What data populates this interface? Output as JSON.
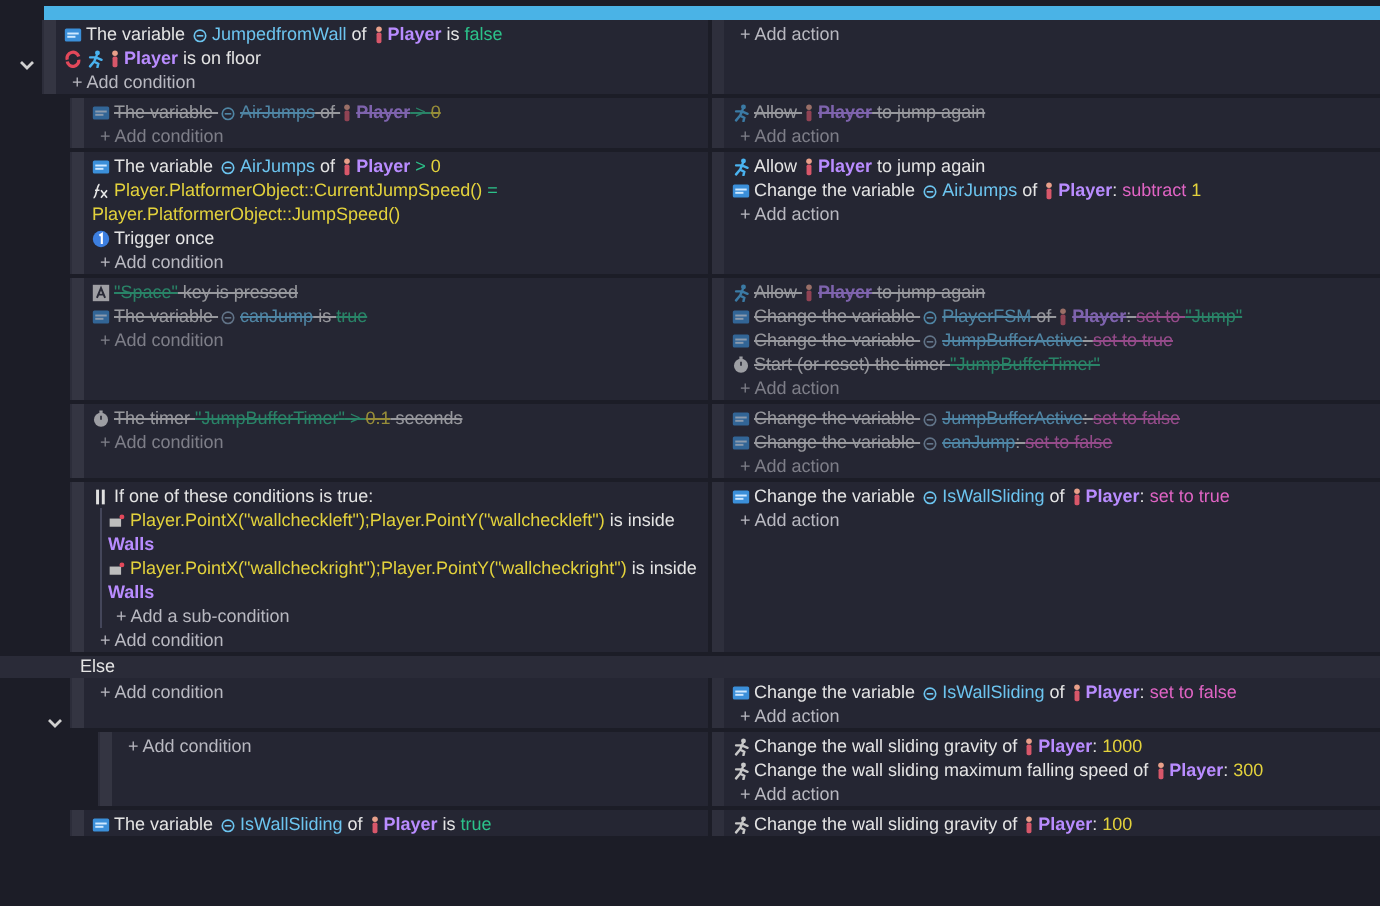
{
  "events": [
    {
      "kind": "event",
      "disabled": false,
      "expanded": true,
      "conditions": [
        {
          "kind": "variable",
          "parts": [
            {
              "kind": "plain",
              "text": "The variable "
            },
            {
              "kind": "var",
              "text": "JumpedfromWall"
            },
            {
              "kind": "plain",
              "text": " of "
            },
            {
              "kind": "object",
              "text": "Player"
            },
            {
              "kind": "plain",
              "text": " is "
            },
            {
              "kind": "bool",
              "text": "false"
            }
          ]
        },
        {
          "kind": "floor",
          "parts": [
            {
              "kind": "object",
              "text": "Player"
            },
            {
              "kind": "plain",
              "text": " is on floor"
            }
          ]
        }
      ],
      "add_condition": "+ Add condition",
      "add_action": "+ Add action",
      "children": [
        {
          "kind": "event",
          "disabled": true,
          "conditions": [
            {
              "kind": "variable",
              "parts": [
                {
                  "kind": "plain",
                  "text": "The variable "
                },
                {
                  "kind": "var",
                  "text": "AirJumps"
                },
                {
                  "kind": "plain",
                  "text": " of "
                },
                {
                  "kind": "object",
                  "text": "Player"
                },
                {
                  "kind": "op",
                  "text": " > "
                },
                {
                  "kind": "num",
                  "text": "0"
                }
              ]
            }
          ],
          "add_condition": "+ Add condition",
          "actions": [
            {
              "kind": "platformer",
              "parts": [
                {
                  "kind": "plain",
                  "text": "Allow "
                },
                {
                  "kind": "object",
                  "text": "Player"
                },
                {
                  "kind": "plain",
                  "text": " to jump again"
                }
              ]
            }
          ],
          "add_action": "+ Add action"
        },
        {
          "kind": "event",
          "disabled": false,
          "conditions": [
            {
              "kind": "variable",
              "parts": [
                {
                  "kind": "plain",
                  "text": "The variable "
                },
                {
                  "kind": "var",
                  "text": "AirJumps"
                },
                {
                  "kind": "plain",
                  "text": " of "
                },
                {
                  "kind": "object",
                  "text": "Player"
                },
                {
                  "kind": "op",
                  "text": " > "
                },
                {
                  "kind": "num",
                  "text": "0"
                }
              ]
            },
            {
              "kind": "expression",
              "parts": [
                {
                  "kind": "expr",
                  "text": "Player.PlatformerObject::CurrentJumpSpeed()"
                },
                {
                  "kind": "op",
                  "text": " = "
                },
                {
                  "kind": "expr",
                  "text": "Player.PlatformerObject::JumpSpeed()"
                }
              ]
            },
            {
              "kind": "once",
              "parts": [
                {
                  "kind": "plain",
                  "text": "Trigger once"
                }
              ]
            }
          ],
          "add_condition": "+ Add condition",
          "actions": [
            {
              "kind": "platformer",
              "parts": [
                {
                  "kind": "plain",
                  "text": "Allow "
                },
                {
                  "kind": "object",
                  "text": "Player"
                },
                {
                  "kind": "plain",
                  "text": " to jump again"
                }
              ]
            },
            {
              "kind": "variable",
              "parts": [
                {
                  "kind": "plain",
                  "text": "Change the variable "
                },
                {
                  "kind": "var",
                  "text": "AirJumps"
                },
                {
                  "kind": "plain",
                  "text": " of "
                },
                {
                  "kind": "object",
                  "text": "Player"
                },
                {
                  "kind": "plain",
                  "text": ": "
                },
                {
                  "kind": "act",
                  "text": "subtract"
                },
                {
                  "kind": "num",
                  "text": " 1"
                }
              ]
            }
          ],
          "add_action": "+ Add action"
        },
        {
          "kind": "event",
          "disabled": true,
          "conditions": [
            {
              "kind": "key",
              "parts": [
                {
                  "kind": "str",
                  "text": "\"Space\""
                },
                {
                  "kind": "plain",
                  "text": " key is pressed"
                }
              ]
            },
            {
              "kind": "variable",
              "parts": [
                {
                  "kind": "plain",
                  "text": "The variable "
                },
                {
                  "kind": "gvar",
                  "text": "canJump"
                },
                {
                  "kind": "plain",
                  "text": " is "
                },
                {
                  "kind": "bool",
                  "text": "true"
                }
              ]
            }
          ],
          "add_condition": "+ Add condition",
          "actions": [
            {
              "kind": "platformer",
              "parts": [
                {
                  "kind": "plain",
                  "text": "Allow "
                },
                {
                  "kind": "object",
                  "text": "Player"
                },
                {
                  "kind": "plain",
                  "text": " to jump again"
                }
              ]
            },
            {
              "kind": "variable",
              "parts": [
                {
                  "kind": "plain",
                  "text": "Change the variable "
                },
                {
                  "kind": "var",
                  "text": "PlayerFSM"
                },
                {
                  "kind": "plain",
                  "text": " of "
                },
                {
                  "kind": "object",
                  "text": "Player"
                },
                {
                  "kind": "plain",
                  "text": ": "
                },
                {
                  "kind": "act",
                  "text": "set to "
                },
                {
                  "kind": "str",
                  "text": "\"Jump\""
                }
              ]
            },
            {
              "kind": "variable",
              "parts": [
                {
                  "kind": "plain",
                  "text": "Change the variable "
                },
                {
                  "kind": "gvar",
                  "text": "JumpBufferActive"
                },
                {
                  "kind": "plain",
                  "text": ": "
                },
                {
                  "kind": "act",
                  "text": "set to true"
                }
              ]
            },
            {
              "kind": "timer",
              "parts": [
                {
                  "kind": "plain",
                  "text": "Start (or reset) the timer "
                },
                {
                  "kind": "str",
                  "text": "\"JumpBufferTimer\""
                }
              ]
            }
          ],
          "add_action": "+ Add action"
        },
        {
          "kind": "event",
          "disabled": true,
          "conditions": [
            {
              "kind": "timer",
              "parts": [
                {
                  "kind": "plain",
                  "text": "The timer "
                },
                {
                  "kind": "str",
                  "text": "\"JumpBufferTimer\""
                },
                {
                  "kind": "op",
                  "text": " > "
                },
                {
                  "kind": "num",
                  "text": "0.1"
                },
                {
                  "kind": "plain",
                  "text": " seconds"
                }
              ]
            }
          ],
          "add_condition": "+ Add condition",
          "actions": [
            {
              "kind": "variable",
              "parts": [
                {
                  "kind": "plain",
                  "text": "Change the variable "
                },
                {
                  "kind": "gvar",
                  "text": "JumpBufferActive"
                },
                {
                  "kind": "plain",
                  "text": ": "
                },
                {
                  "kind": "act",
                  "text": "set to false"
                }
              ]
            },
            {
              "kind": "variable",
              "parts": [
                {
                  "kind": "plain",
                  "text": "Change the variable "
                },
                {
                  "kind": "gvar",
                  "text": "canJump"
                },
                {
                  "kind": "plain",
                  "text": ": "
                },
                {
                  "kind": "act",
                  "text": "set to false"
                }
              ]
            }
          ],
          "add_action": "+ Add action"
        },
        {
          "kind": "event",
          "disabled": false,
          "conditions": [
            {
              "kind": "or",
              "parts": [
                {
                  "kind": "plain",
                  "text": "If one of these conditions is true:"
                }
              ],
              "sub_conditions": [
                {
                  "kind": "point",
                  "parts": [
                    {
                      "kind": "expr",
                      "text": "Player.PointX(\"wallcheckleft\");Player.PointY(\"wallcheckleft\")"
                    },
                    {
                      "kind": "plain",
                      "text": " is inside "
                    },
                    {
                      "kind": "objname",
                      "text": "Walls"
                    }
                  ]
                },
                {
                  "kind": "point",
                  "parts": [
                    {
                      "kind": "expr",
                      "text": "Player.PointX(\"wallcheckright\");Player.PointY(\"wallcheckright\")"
                    },
                    {
                      "kind": "plain",
                      "text": " is inside "
                    },
                    {
                      "kind": "objname",
                      "text": "Walls"
                    }
                  ]
                }
              ],
              "add_subcondition": "+ Add a sub-condition"
            }
          ],
          "add_condition": "+ Add condition",
          "actions": [
            {
              "kind": "variable",
              "parts": [
                {
                  "kind": "plain",
                  "text": "Change the variable "
                },
                {
                  "kind": "var",
                  "text": "IsWallSliding"
                },
                {
                  "kind": "plain",
                  "text": " of "
                },
                {
                  "kind": "object",
                  "text": "Player"
                },
                {
                  "kind": "plain",
                  "text": ": "
                },
                {
                  "kind": "act",
                  "text": "set to true"
                }
              ]
            }
          ],
          "add_action": "+ Add action"
        },
        {
          "kind": "else",
          "label": "Else",
          "disabled": false,
          "expanded": true,
          "add_condition": "+ Add condition",
          "actions": [
            {
              "kind": "variable",
              "parts": [
                {
                  "kind": "plain",
                  "text": "Change the variable "
                },
                {
                  "kind": "var",
                  "text": "IsWallSliding"
                },
                {
                  "kind": "plain",
                  "text": " of "
                },
                {
                  "kind": "object",
                  "text": "Player"
                },
                {
                  "kind": "plain",
                  "text": ": "
                },
                {
                  "kind": "act",
                  "text": "set to false"
                }
              ]
            }
          ],
          "add_action": "+ Add action",
          "children": [
            {
              "kind": "event",
              "disabled": false,
              "add_condition": "+ Add condition",
              "actions": [
                {
                  "kind": "wallslide",
                  "parts": [
                    {
                      "kind": "plain",
                      "text": "Change the wall sliding gravity of "
                    },
                    {
                      "kind": "object",
                      "text": "Player"
                    },
                    {
                      "kind": "plain",
                      "text": ": "
                    },
                    {
                      "kind": "num",
                      "text": "1000"
                    }
                  ]
                },
                {
                  "kind": "wallslide",
                  "parts": [
                    {
                      "kind": "plain",
                      "text": "Change the wall sliding maximum falling speed of "
                    },
                    {
                      "kind": "object",
                      "text": "Player"
                    },
                    {
                      "kind": "plain",
                      "text": ": "
                    },
                    {
                      "kind": "num",
                      "text": "300"
                    }
                  ]
                }
              ],
              "add_action": "+ Add action"
            }
          ]
        },
        {
          "kind": "event",
          "disabled": false,
          "conditions": [
            {
              "kind": "variable",
              "parts": [
                {
                  "kind": "plain",
                  "text": "The variable "
                },
                {
                  "kind": "var",
                  "text": "IsWallSliding"
                },
                {
                  "kind": "plain",
                  "text": " of "
                },
                {
                  "kind": "object",
                  "text": "Player"
                },
                {
                  "kind": "plain",
                  "text": " is "
                },
                {
                  "kind": "bool",
                  "text": "true"
                }
              ]
            }
          ],
          "actions": [
            {
              "kind": "wallslide",
              "parts": [
                {
                  "kind": "plain",
                  "text": "Change the wall sliding gravity of "
                },
                {
                  "kind": "object",
                  "text": "Player"
                },
                {
                  "kind": "plain",
                  "text": ": "
                },
                {
                  "kind": "num",
                  "text": "100"
                }
              ]
            }
          ]
        }
      ]
    }
  ]
}
